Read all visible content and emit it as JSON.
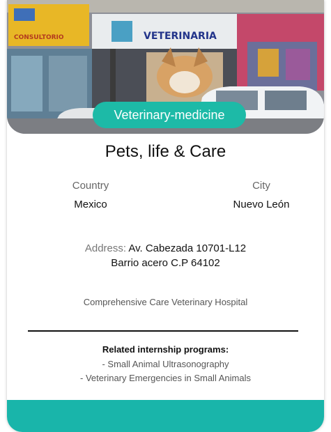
{
  "card": {
    "category_badge": "Veterinary-medicine",
    "title": "Pets, life & Care",
    "country_label": "Country",
    "country_value": "Mexico",
    "city_label": "City",
    "city_value": "Nuevo León",
    "address_label": "Address:",
    "address_line1": "Av. Cabezada 10701-L12",
    "address_line2": "Barrio acero C.P 64102",
    "description": "Comprehensive Care Veterinary Hospital",
    "programs_heading": "Related internship programs:",
    "programs": [
      "- Small Animal Ultrasonography",
      "- Veterinary Emergencies in Small Animals"
    ]
  },
  "photo": {
    "sign_left": "CONSULTORIO",
    "sign_center": "VETERINARIA"
  },
  "colors": {
    "accent": "#1dbaa7",
    "footer": "#19b5aa"
  }
}
